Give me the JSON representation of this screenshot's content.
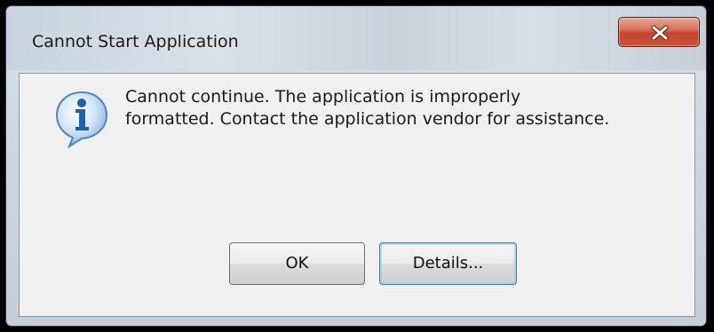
{
  "window": {
    "title": "Cannot Start Application"
  },
  "message": {
    "line1": "Cannot continue. The application is improperly",
    "line2": "formatted. Contact the application vendor for assistance."
  },
  "buttons": {
    "ok_label": "OK",
    "details_label": "Details..."
  },
  "icons": {
    "message_icon": "information-icon",
    "close_icon": "close-icon"
  },
  "colors": {
    "close_button": "#c4432b",
    "info_icon": "#2a6fc0",
    "focused_button_border": "#3c7fb1"
  }
}
